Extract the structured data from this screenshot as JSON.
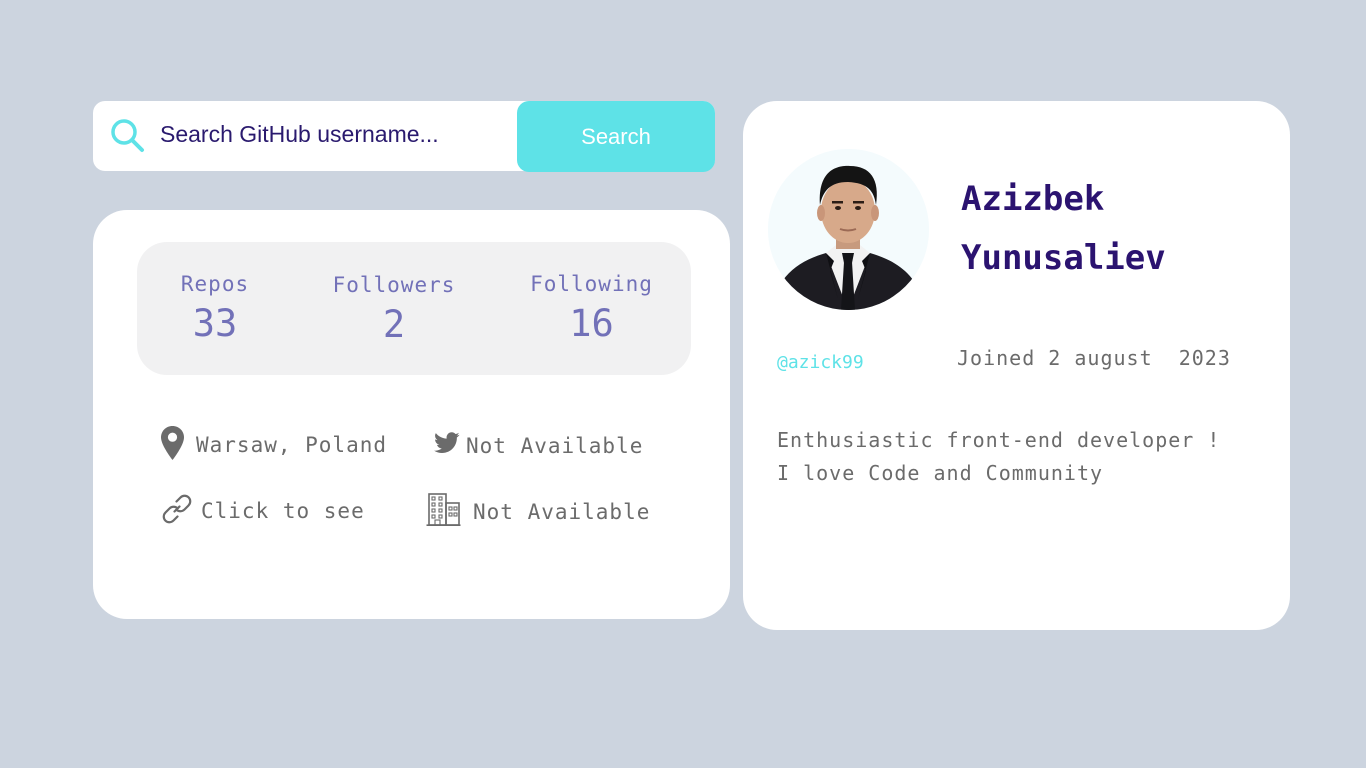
{
  "search": {
    "placeholder": "Search GitHub username...",
    "button_label": "Search"
  },
  "stats": [
    {
      "label": "Repos",
      "value": "33"
    },
    {
      "label": "Followers",
      "value": "2"
    },
    {
      "label": "Following",
      "value": "16"
    }
  ],
  "info": {
    "location": "Warsaw, Poland",
    "twitter": "Not Available",
    "blog": "Click to see",
    "company": "Not Available"
  },
  "profile": {
    "name": "Azizbek Yunusaliev",
    "login": "@azick99",
    "joined": "Joined 2 august  2023",
    "bio": "Enthusiastic front-end developer ! I love Code and Community"
  },
  "icons": {
    "search": "search-icon",
    "location": "location-pin-icon",
    "twitter": "twitter-icon",
    "blog": "link-icon",
    "company": "building-icon",
    "avatar": "avatar-photo"
  },
  "colors": {
    "background": "#ccd4df",
    "accent": "#5ee2e7",
    "heading": "#2b1370",
    "stat_text": "#7271b8",
    "muted_text": "#6b6b6b",
    "panel": "#f1f1f2",
    "card": "#ffffff"
  }
}
